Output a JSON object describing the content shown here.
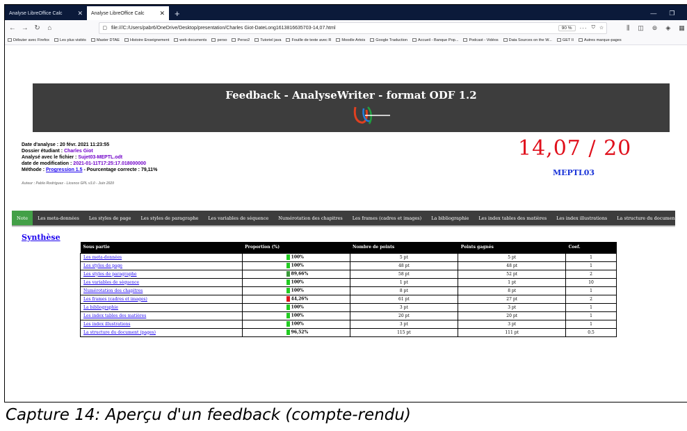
{
  "browser": {
    "tabs": [
      {
        "label": "Analyse LibreOffice Calc",
        "active": false
      },
      {
        "label": "Analyse LibreOffice Calc",
        "active": true
      }
    ],
    "url": "file:///C:/Users/pabr6/OneDrive/Desktop/presentation/Charles Giot-DateLong1613816635703-14,07.html",
    "zoom": "90 %",
    "bookmarks": [
      "Débuter avec Firefox",
      "Les plus visités",
      "Master DTAE",
      "Histoire Enseignement",
      "web documents",
      "perso",
      "Perso2",
      "Tutoriel java",
      "Fouille de texte avec R",
      "Moodle Artois",
      "Google Traduction",
      "Accueil - Banque Pop...",
      "Podcast - Vidéos",
      "Data Sources on the W...",
      "GET II",
      "Autres marque-pages"
    ]
  },
  "page": {
    "banner_title": "Feedback - AnalyseWriter - format ODF 1.2",
    "info": {
      "date_label": "Date d'analyse : ",
      "date_value": "20 févr. 2021 11:23:55",
      "student_label": "Dossier étudiant : ",
      "student_value": "Charles Giot",
      "file_label": "Analysé avec le fichier : ",
      "file_value": "Sujet03-MEPTL.odt",
      "modif_label": "date de modification : ",
      "modif_value": "2021-01-11T17:25:17.018000000",
      "method_label": "Méthode : ",
      "method_link": "Progression 1.5",
      "method_tail": " - Pourcentage correcte : 79,11%"
    },
    "author": "Auteur : Pablo Rodriguez - Licence GPL v3.0 - Juin 2020",
    "score": "14,07 / 20",
    "score_sub": "MEPTL03",
    "menu": [
      "Note",
      "Les meta-données",
      "Les styles de page",
      "Les styles de paragraphe",
      "Les variables de séquence",
      "Numérotation des chapitres",
      "Les frames (cadres et images)",
      "La bibliographie",
      "Les index tables des matières",
      "Les index illustrations",
      "La structure du document (pages)"
    ],
    "section_title": "Synthèse",
    "table": {
      "headers": [
        "Sous partie",
        "Proportion (%)",
        "Nombre de points",
        "Points gagnés",
        "Coef."
      ],
      "rows": [
        {
          "name": "Les meta-données",
          "pct": "100%",
          "color": "#22cc22",
          "points": "5 pt",
          "gained": "5 pt",
          "coef": "1"
        },
        {
          "name": "Les styles de page",
          "pct": "100%",
          "color": "#22cc22",
          "points": "48 pt",
          "gained": "48 pt",
          "coef": "1"
        },
        {
          "name": "Les styles de paragraphe",
          "pct": "89,66%",
          "color": "#3a9a3a",
          "points": "58 pt",
          "gained": "52 pt",
          "coef": "2"
        },
        {
          "name": "Les variables de séquence",
          "pct": "100%",
          "color": "#22cc22",
          "points": "1 pt",
          "gained": "1 pt",
          "coef": "10"
        },
        {
          "name": "Numérotation des chapitres",
          "pct": "100%",
          "color": "#22cc22",
          "points": "8 pt",
          "gained": "8 pt",
          "coef": "1"
        },
        {
          "name": "Les frames (cadres et images)",
          "pct": "44,26%",
          "color": "#e0101c",
          "points": "61 pt",
          "gained": "27 pt",
          "coef": "2"
        },
        {
          "name": "La bibliographie",
          "pct": "100%",
          "color": "#22cc22",
          "points": "3 pt",
          "gained": "3 pt",
          "coef": "1"
        },
        {
          "name": "Les index tables des matières",
          "pct": "100%",
          "color": "#22cc22",
          "points": "20 pt",
          "gained": "20 pt",
          "coef": "1"
        },
        {
          "name": "Les index illustrations",
          "pct": "100%",
          "color": "#22cc22",
          "points": "3 pt",
          "gained": "3 pt",
          "coef": "1"
        },
        {
          "name": "La structure du document (pages)",
          "pct": "96,52%",
          "color": "#22cc22",
          "points": "115 pt",
          "gained": "111 pt",
          "coef": "0.5"
        }
      ]
    }
  },
  "caption": "Capture 14: Aperçu d'un feedback (compte-rendu)"
}
